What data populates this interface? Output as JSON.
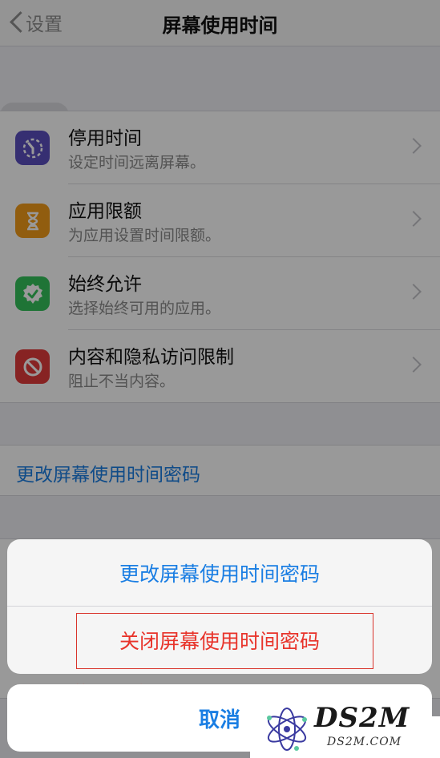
{
  "nav": {
    "back_label": "设置",
    "title": "屏幕使用时间"
  },
  "settings": [
    {
      "title": "停用时间",
      "subtitle": "设定时间远离屏幕。",
      "icon": "downtime-icon",
      "color": "#5a4fbf"
    },
    {
      "title": "应用限额",
      "subtitle": "为应用设置时间限额。",
      "icon": "hourglass-icon",
      "color": "#f29b1a"
    },
    {
      "title": "始终允许",
      "subtitle": "选择始终可用的应用。",
      "icon": "checkmark-badge-icon",
      "color": "#35c15a"
    },
    {
      "title": "内容和隐私访问限制",
      "subtitle": "阻止不当内容。",
      "icon": "restriction-icon",
      "color": "#e23b3b"
    }
  ],
  "passcode_link": "更改屏幕使用时间密码",
  "action_sheet": {
    "change_passcode": "更改屏幕使用时间密码",
    "turn_off_passcode": "关闭屏幕使用时间密码",
    "cancel": "取消"
  },
  "behind_text": "关闭屏幕使用时间",
  "watermark": {
    "brand": "DS2M",
    "domain": "DS2M.COM"
  }
}
